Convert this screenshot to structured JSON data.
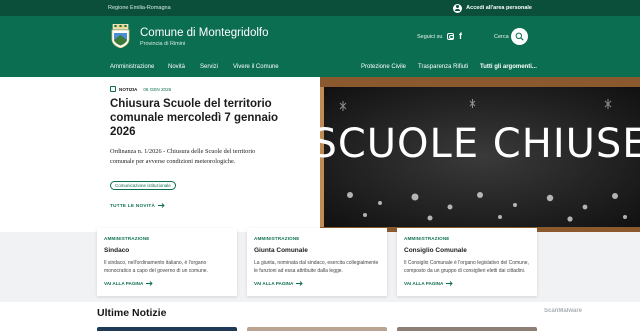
{
  "slim": {
    "region": "Regione Emilia-Romagna",
    "login": "Accedi all'area personale"
  },
  "header": {
    "title": "Comune di Montegridolfo",
    "subtitle": "Provincia di Rimini",
    "social_label": "Seguici su",
    "search_label": "Cerca"
  },
  "nav": {
    "items": [
      "Amministrazione",
      "Novità",
      "Servizi",
      "Vivere il Comune"
    ],
    "secondary": [
      "Protezione Civile",
      "Trasparenza Rifiuti",
      "Tutti gli argomenti..."
    ]
  },
  "hero": {
    "category": "NOTIZIA",
    "date": "06 GEN 2026",
    "title": "Chiusura Scuole del territorio comunale mercoledì 7 gennaio 2026",
    "abstract": "Ordinanza n. 1/2026 - Chiusura delle Scuole del territorio comunale per avverse condizioni meteorologiche.",
    "tag": "Comunicazione istituzionale",
    "link": "TUTTE LE NOVITÀ",
    "image_text": "SCUOLE CHIUSE"
  },
  "cards": [
    {
      "category": "AMMINISTRAZIONE",
      "title": "Sindaco",
      "text": "Il sindaco, nell'ordinamento italiano, è l'organo monocratico a capo del governo di un comune.",
      "link": "VAI ALLA PAGINA"
    },
    {
      "category": "AMMINISTRAZIONE",
      "title": "Giunta Comunale",
      "text": "La giunta, nominata dal sindaco, esercita collegialmente le funzioni ad essa attribuite dalla legge.",
      "link": "VAI ALLA PAGINA"
    },
    {
      "category": "AMMINISTRAZIONE",
      "title": "Consiglio Comunale",
      "text": "Il Consiglio Comunale è l'organo legislativo del Comune, composto da un gruppo di consiglieri eletti dai cittadini.",
      "link": "VAI ALLA PAGINA"
    }
  ],
  "latest": {
    "title": "Ultime Notizie"
  },
  "watermark": "ScanMalware",
  "colors": {
    "primary": "#0c6e50",
    "dark": "#0b4f3b",
    "band": "#f1f2f4"
  }
}
